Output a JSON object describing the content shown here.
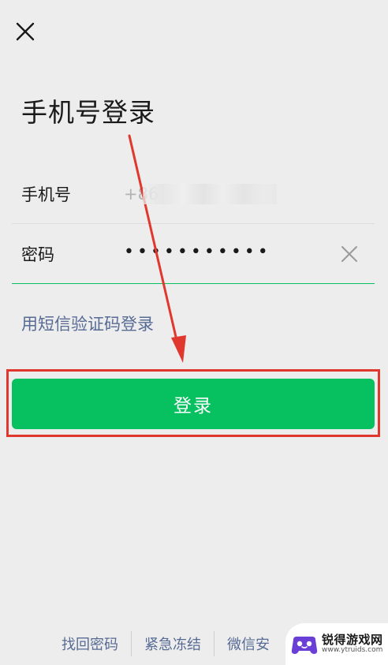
{
  "header": {
    "close_icon": "close-icon",
    "title": "手机号登录"
  },
  "form": {
    "phone_label": "手机号",
    "phone_prefix": "+86",
    "password_label": "密码",
    "password_value": "•••••••••••",
    "clear_icon": "clear-icon",
    "accent_color": "#07c160"
  },
  "sms_login_link": "用短信验证码登录",
  "login_button": {
    "label": "登录",
    "color": "#07c160"
  },
  "annotation": {
    "box_color": "#e0382e",
    "arrow_color": "#e0382e"
  },
  "footer": {
    "links": [
      "找回密码",
      "紧急冻结",
      "微信安"
    ]
  },
  "watermark": {
    "title": "锐得游戏网",
    "url": "www.ytruids.com"
  }
}
